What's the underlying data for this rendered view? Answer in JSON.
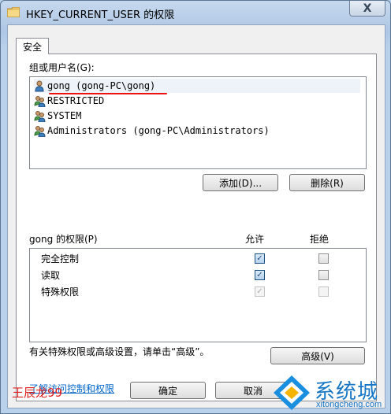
{
  "window": {
    "title": "HKEY_CURRENT_USER 的权限",
    "close_label": "X"
  },
  "tabs": [
    {
      "label": "安全"
    }
  ],
  "users": {
    "label": "组或用户名(G):",
    "items": [
      {
        "name": "gong (gong-PC\\gong)"
      },
      {
        "name": "RESTRICTED"
      },
      {
        "name": "SYSTEM"
      },
      {
        "name": "Administrators (gong-PC\\Administrators)"
      }
    ],
    "add_label": "添加(D)...",
    "remove_label": "删除(R)"
  },
  "permissions": {
    "label": "gong 的权限(P)",
    "allow_header": "允许",
    "deny_header": "拒绝",
    "rows": [
      {
        "name": "完全控制",
        "allow": true,
        "allow_disabled": false,
        "deny": false,
        "deny_disabled": false
      },
      {
        "name": "读取",
        "allow": true,
        "allow_disabled": false,
        "deny": false,
        "deny_disabled": false
      },
      {
        "name": "特殊权限",
        "allow": true,
        "allow_disabled": true,
        "deny": false,
        "deny_disabled": true
      }
    ]
  },
  "advanced": {
    "text": "有关特殊权限或高级设置，请单击“高级”。",
    "button_label": "高级(V)"
  },
  "help_link": "了解访问控制和权限",
  "footer": {
    "ok_label": "确定",
    "cancel_label": "取消",
    "author_mark": "王辰龙99"
  },
  "logo": {
    "name": "系统城",
    "url": "xitongcheng.com"
  },
  "icons": {
    "title": "folder-icon",
    "user": "user-icon",
    "group": "group-icon",
    "check": "checkmark-icon"
  },
  "colors": {
    "window_frame": "#b9d1ea",
    "link": "#0066cc",
    "watermark": "#e02020",
    "logo": "#1776c6"
  }
}
